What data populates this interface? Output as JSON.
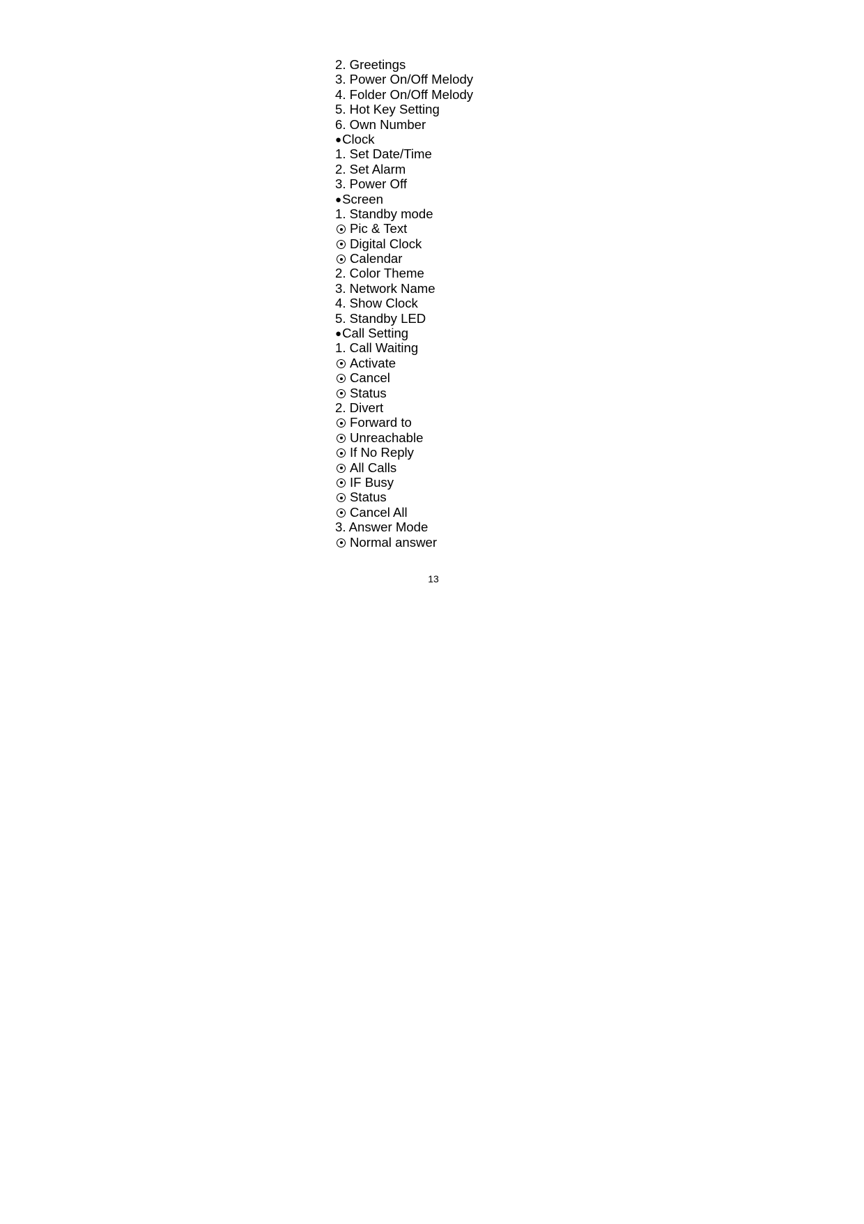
{
  "document": {
    "page_number": "13",
    "lines": [
      {
        "type": "item",
        "text": "2. Greetings"
      },
      {
        "type": "item",
        "text": "3. Power On/Off Melody"
      },
      {
        "type": "item",
        "text": "4. Folder On/Off Melody"
      },
      {
        "type": "item",
        "text": "5. Hot Key Setting"
      },
      {
        "type": "item",
        "text": "6. Own Number"
      },
      {
        "type": "section",
        "bullet": "●",
        "text": "Clock"
      },
      {
        "type": "item",
        "text": "1. Set Date/Time"
      },
      {
        "type": "item",
        "text": "2. Set Alarm"
      },
      {
        "type": "item",
        "text": "3. Power Off"
      },
      {
        "type": "section",
        "bullet": "●",
        "text": "Screen"
      },
      {
        "type": "item",
        "text": "1. Standby mode"
      },
      {
        "type": "option",
        "icon": "radio-dot-icon",
        "text": "Pic & Text"
      },
      {
        "type": "option",
        "icon": "radio-dot-icon",
        "text": "Digital Clock"
      },
      {
        "type": "option",
        "icon": "radio-dot-icon",
        "text": "Calendar"
      },
      {
        "type": "item",
        "text": "2. Color Theme"
      },
      {
        "type": "item",
        "text": "3. Network Name"
      },
      {
        "type": "item",
        "text": "4. Show Clock"
      },
      {
        "type": "item",
        "text": "5. Standby LED"
      },
      {
        "type": "section",
        "bullet": "●",
        "text": "Call Setting"
      },
      {
        "type": "item",
        "text": "1. Call Waiting"
      },
      {
        "type": "option",
        "icon": "radio-dot-icon",
        "text": "Activate"
      },
      {
        "type": "option",
        "icon": "radio-dot-icon",
        "text": "Cancel"
      },
      {
        "type": "option",
        "icon": "radio-dot-icon",
        "text": "Status"
      },
      {
        "type": "item",
        "text": "2. Divert"
      },
      {
        "type": "option",
        "icon": "radio-dot-icon",
        "text": "Forward to"
      },
      {
        "type": "option",
        "icon": "radio-dot-icon",
        "text": "Unreachable"
      },
      {
        "type": "option",
        "icon": "radio-dot-icon",
        "text": "If No Reply"
      },
      {
        "type": "option",
        "icon": "radio-dot-icon",
        "text": "All Calls"
      },
      {
        "type": "option",
        "icon": "radio-dot-icon",
        "text": "IF Busy"
      },
      {
        "type": "option",
        "icon": "radio-dot-icon",
        "text": "Status"
      },
      {
        "type": "option",
        "icon": "radio-dot-icon",
        "text": "Cancel All"
      },
      {
        "type": "item",
        "text": "3. Answer Mode"
      },
      {
        "type": "option",
        "icon": "radio-dot-icon",
        "text": "Normal answer"
      }
    ]
  }
}
